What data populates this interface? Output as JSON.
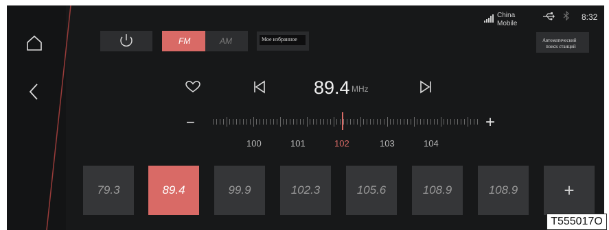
{
  "status_bar": {
    "carrier_line1": "China",
    "carrier_line2": "Mobile",
    "time": "8:32",
    "icons": [
      "signal-icon",
      "usb-icon",
      "bluetooth-icon"
    ]
  },
  "controls": {
    "band_fm": "FM",
    "band_am": "AM",
    "selected_band": "FM",
    "favorites_label": "Мое избранное",
    "autosearch_line1": "Автоматический",
    "autosearch_line2": "поиск станций"
  },
  "tuner": {
    "frequency": "89.4",
    "unit": "MHz",
    "minus": "−",
    "plus": "+",
    "scale_labels": [
      "100",
      "101",
      "102",
      "103",
      "104"
    ],
    "highlighted_label": "102"
  },
  "presets": [
    "79.3",
    "89.4",
    "99.9",
    "102.3",
    "105.6",
    "108.9",
    "108.9"
  ],
  "active_preset": "89.4",
  "add_preset": "+",
  "watermark": "T555017O",
  "colors": {
    "accent": "#d96a66",
    "background": "#171819",
    "panel": "#353638"
  }
}
